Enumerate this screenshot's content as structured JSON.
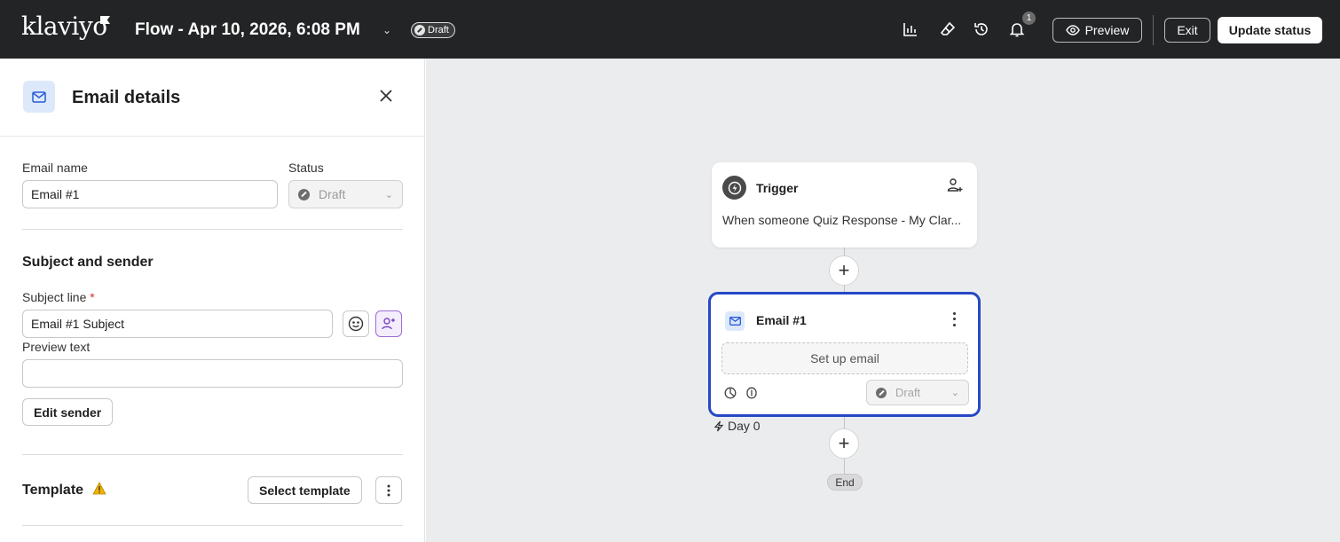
{
  "header": {
    "logo_text": "klaviyo",
    "flow_title": "Flow - Apr 10, 2026, 6:08 PM",
    "status_badge": "Draft",
    "notification_count": "1",
    "preview_label": "Preview",
    "exit_label": "Exit",
    "update_status_label": "Update status"
  },
  "panel": {
    "title": "Email details",
    "email_name_label": "Email name",
    "email_name_value": "Email #1",
    "status_label": "Status",
    "status_value": "Draft",
    "subject_section_title": "Subject and sender",
    "subject_line_label": "Subject line",
    "required_mark": "*",
    "subject_line_value": "Email #1 Subject",
    "preview_text_label": "Preview text",
    "preview_text_value": "",
    "edit_sender_label": "Edit sender",
    "template_label": "Template",
    "select_template_label": "Select template"
  },
  "canvas": {
    "trigger": {
      "title": "Trigger",
      "description": "When someone Quiz Response - My Clar..."
    },
    "email_node": {
      "title": "Email #1",
      "setup_label": "Set up email",
      "status_value": "Draft"
    },
    "delay_label": "Day 0",
    "end_label": "End",
    "plus_symbol": "+"
  },
  "colors": {
    "topbar": "#232426",
    "selected_node_border": "#2648c7",
    "canvas_bg": "#ebecee",
    "warning": "#f0b400",
    "ai_accent": "#9a6cd6"
  }
}
